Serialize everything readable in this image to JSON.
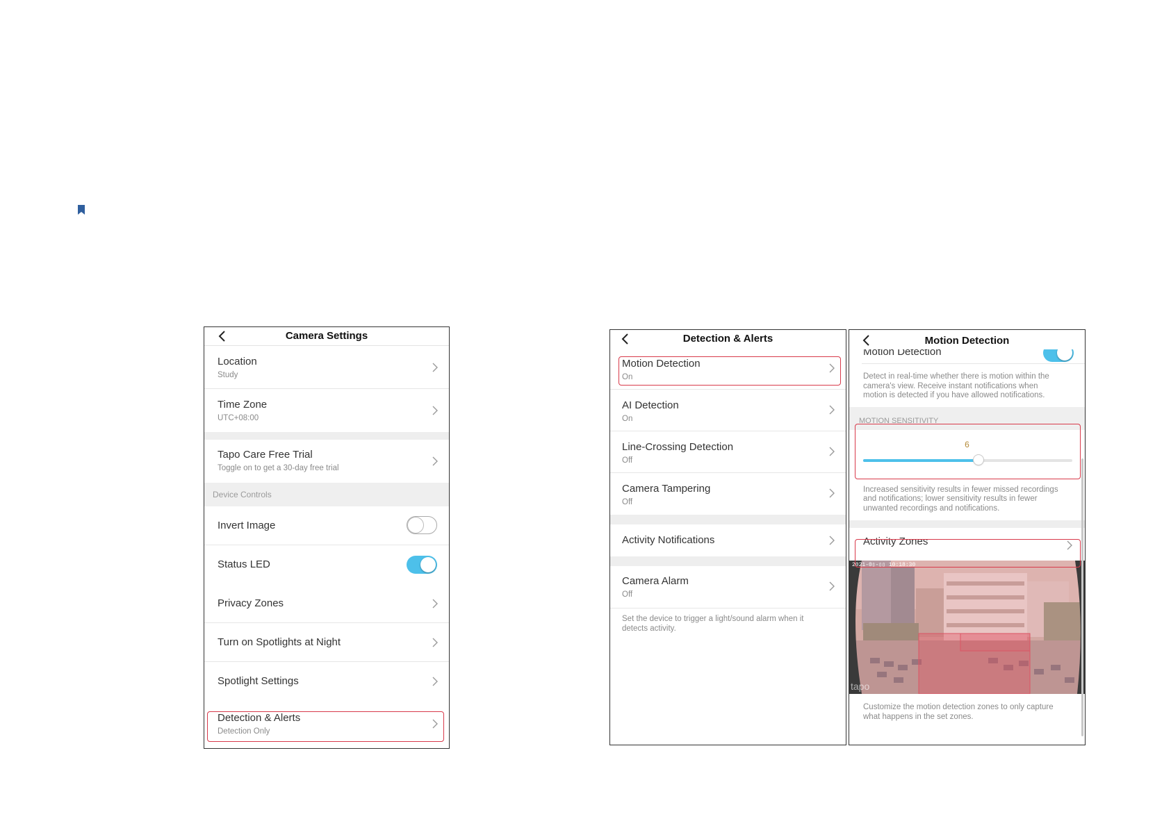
{
  "colors": {
    "accent": "#4dc0ea",
    "highlight": "#d8394a",
    "bookmark": "#2f5f9e"
  },
  "bookmark_icon": "bookmark-icon",
  "camera_settings": {
    "title": "Camera Settings",
    "location": {
      "label": "Location",
      "value": "Study"
    },
    "time_zone": {
      "label": "Time Zone",
      "value": "UTC+08:00"
    },
    "tapo_care": {
      "label": "Tapo Care Free Trial",
      "value": "Toggle on to get a 30-day free trial"
    },
    "device_controls_header": "Device Controls",
    "invert_image": {
      "label": "Invert Image",
      "on": false
    },
    "status_led": {
      "label": "Status LED",
      "on": true
    },
    "privacy_zones": "Privacy Zones",
    "spotlights_night": "Turn on Spotlights at Night",
    "spotlight_settings": "Spotlight Settings",
    "detection_alerts": {
      "label": "Detection & Alerts",
      "value": "Detection Only"
    }
  },
  "detection_alerts": {
    "title": "Detection & Alerts",
    "motion_detection": {
      "label": "Motion Detection",
      "value": "On"
    },
    "ai_detection": {
      "label": "AI Detection",
      "value": "On"
    },
    "line_crossing": {
      "label": "Line-Crossing Detection",
      "value": "Off"
    },
    "camera_tampering": {
      "label": "Camera Tampering",
      "value": "Off"
    },
    "activity_notifications": "Activity Notifications",
    "camera_alarm": {
      "label": "Camera Alarm",
      "value": "Off"
    },
    "alarm_desc_1": "Set the device to trigger a light/sound alarm when it",
    "alarm_desc_2": "detects activity."
  },
  "motion_detection": {
    "title": "Motion Detection",
    "toggle_label": "Motion Detection",
    "toggle_on": true,
    "desc_1": "Detect in real-time whether there is motion within the",
    "desc_2": "camera's view. Receive instant notifications when",
    "desc_3": "motion is detected if you have allowed notifications.",
    "sensitivity_header": "MOTION SENSITIVITY",
    "sensitivity_value": "6",
    "sensitivity_fraction": 0.55,
    "sens_desc_1": "Increased sensitivity results in fewer missed recordings",
    "sens_desc_2": "and notifications; lower sensitivity results in fewer",
    "sens_desc_3": "unwanted recordings and notifications.",
    "activity_zones": "Activity Zones",
    "zones_desc_1": "Customize the motion detection zones to only capture",
    "zones_desc_2": "what happens in the set zones."
  }
}
